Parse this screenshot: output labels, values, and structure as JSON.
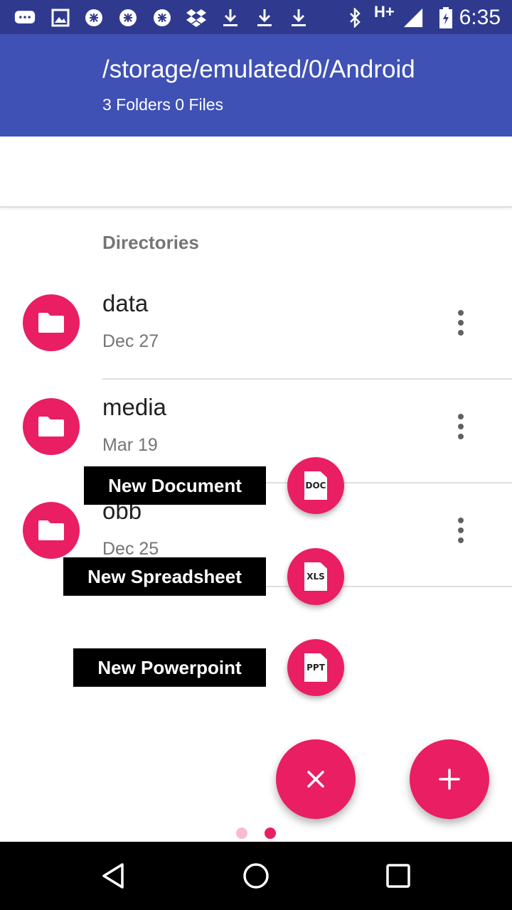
{
  "status_bar": {
    "time": "6:35",
    "network": "H+",
    "icons": [
      "chat-icon",
      "image-icon",
      "sync-icon",
      "sync-icon",
      "sync-icon",
      "dropbox-icon",
      "download-icon",
      "download-icon",
      "download-icon",
      "bluetooth-icon",
      "signal-icon",
      "battery-icon"
    ]
  },
  "header": {
    "path": "/storage/emulated/0/Android",
    "summary": "3 Folders 0 Files"
  },
  "section": {
    "title": "Directories"
  },
  "folders": [
    {
      "name": "data",
      "date": "Dec 27"
    },
    {
      "name": "media",
      "date": "Mar 19"
    },
    {
      "name": "obb",
      "date": "Dec 25"
    }
  ],
  "fab_menu": {
    "new_document": {
      "label": "New Document",
      "icon_text": "DOC"
    },
    "new_spreadsheet": {
      "label": "New Spreadsheet",
      "icon_text": "XLS"
    },
    "new_powerpoint": {
      "label": "New Powerpoint",
      "icon_text": "PPT"
    }
  },
  "colors": {
    "status_bar": "#2f3a8f",
    "app_bar": "#3f51b5",
    "accent": "#e91e63"
  },
  "pager": {
    "count": 2,
    "active": 2
  }
}
